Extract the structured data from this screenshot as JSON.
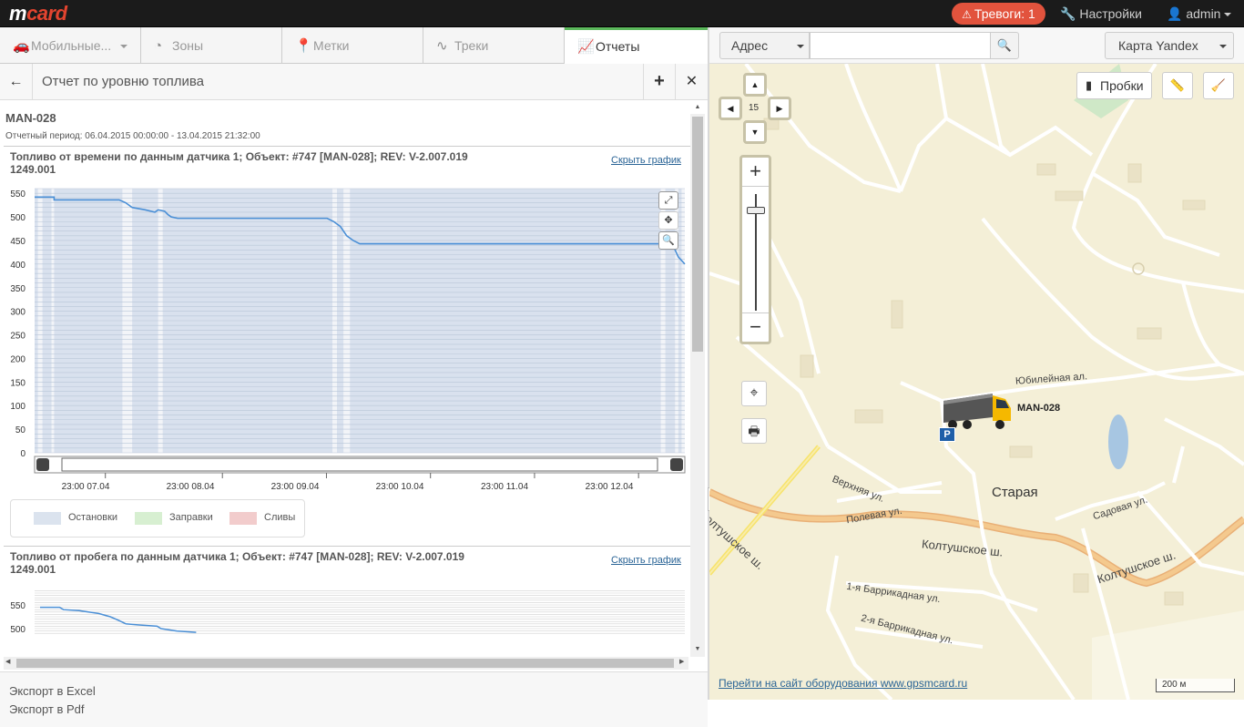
{
  "header": {
    "logo_m": "m",
    "logo_card": "card",
    "alarm_label": "Тревоги: 1",
    "settings_label": "Настройки",
    "user_label": "admin"
  },
  "tabs": [
    {
      "label": "Мобильные..."
    },
    {
      "label": "Зоны"
    },
    {
      "label": "Метки"
    },
    {
      "label": "Треки"
    },
    {
      "label": "Отчеты"
    }
  ],
  "report": {
    "title": "Отчет по уровню топлива",
    "object_name": "MAN-028",
    "period": "Отчетный период: 06.04.2015 00:00:00 - 13.04.2015 21:32:00",
    "hide_chart_label": "Скрыть график",
    "legend": [
      {
        "label": "Остановки",
        "color": "#dbe3ee"
      },
      {
        "label": "Заправки",
        "color": "#d7efd1"
      },
      {
        "label": "Сливы",
        "color": "#f2cccc"
      }
    ]
  },
  "chart_data": [
    {
      "type": "line",
      "title": "Топливо от времени по данным датчика 1; Объект: #747 [MAN-028]; REV: V-2.007.019 1249.001",
      "x_ticks": [
        "23:00 07.04",
        "23:00 08.04",
        "23:00 09.04",
        "23:00 10.04",
        "23:00 11.04",
        "23:00 12.04"
      ],
      "y_ticks": [
        0,
        50,
        100,
        150,
        200,
        250,
        300,
        350,
        400,
        450,
        500,
        550
      ],
      "ylim": [
        0,
        560
      ],
      "series": [
        {
          "color": "#4a8fd6",
          "points": [
            [
              0.0,
              542
            ],
            [
              0.03,
              542
            ],
            [
              0.03,
              536
            ],
            [
              0.13,
              536
            ],
            [
              0.14,
              530
            ],
            [
              0.15,
              520
            ],
            [
              0.17,
              515
            ],
            [
              0.185,
              510
            ],
            [
              0.19,
              515
            ],
            [
              0.2,
              512
            ],
            [
              0.205,
              505
            ],
            [
              0.21,
              500
            ],
            [
              0.22,
              497
            ],
            [
              0.45,
              497
            ],
            [
              0.46,
              490
            ],
            [
              0.47,
              480
            ],
            [
              0.48,
              460
            ],
            [
              0.49,
              450
            ],
            [
              0.5,
              443
            ],
            [
              0.98,
              443
            ],
            [
              0.985,
              430
            ],
            [
              0.99,
              415
            ],
            [
              1.0,
              400
            ]
          ]
        }
      ]
    },
    {
      "type": "line",
      "title": "Топливо от пробега по данным датчика 1; Объект: #747 [MAN-028]; REV: V-2.007.019 1249.001",
      "y_ticks": [
        500,
        550
      ],
      "series": [
        {
          "color": "#4a8fd6",
          "points": [
            [
              0.0,
              545
            ],
            [
              0.05,
              545
            ],
            [
              0.06,
              540
            ],
            [
              0.1,
              538
            ],
            [
              0.15,
              532
            ],
            [
              0.18,
              525
            ],
            [
              0.2,
              518
            ],
            [
              0.22,
              510
            ],
            [
              0.25,
              508
            ],
            [
              0.3,
              505
            ],
            [
              0.31,
              500
            ],
            [
              0.35,
              495
            ],
            [
              0.4,
              492
            ]
          ]
        }
      ]
    }
  ],
  "exports": [
    "Экспорт в Excel",
    "Экспорт в Pdf"
  ],
  "map": {
    "address_select": "Адрес",
    "address_placeholder": "",
    "map_type": "Карта Yandex",
    "traffic_label": "Пробки",
    "zoom_level": "15",
    "vehicle_label": "MAN-028",
    "parking_badge": "P",
    "footer_link": "Перейти на сайт оборудования www.gpsmcard.ru",
    "scale_label": "200 м",
    "labels": {
      "yubileynaya": "Юбилейная ал.",
      "staraya": "Старая",
      "verkhnyaya": "Верхняя ул.",
      "polevaya": "Полевая ул.",
      "sadovaya": "Садовая ул.",
      "koltush1": "Колтушское ш.",
      "koltush2": "Колтушское ш.",
      "koltush3": "Колтушское ш.",
      "barrikadnaya1": "1-я Баррикадная ул.",
      "barrikadnaya2": "2-я Баррикадная ул."
    }
  }
}
